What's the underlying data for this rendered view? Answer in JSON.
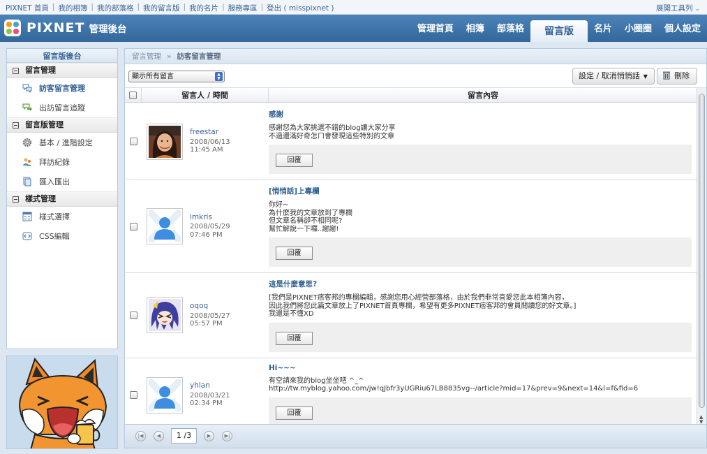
{
  "toplinks": {
    "items": [
      "PIXNET 首頁",
      "我的相簿",
      "我的部落格",
      "我的留言版",
      "我的名片",
      "服務專區",
      "登出 ( misspixnet )"
    ],
    "expand_toolbar": "展開工具列"
  },
  "header": {
    "logo_text": "PIXNET",
    "logo_sub": "管理後台",
    "nav": [
      "管理首頁",
      "相簿",
      "部落格",
      "留言版",
      "名片",
      "小圈圈",
      "個人設定"
    ],
    "active_nav": "留言版"
  },
  "sidebar": {
    "title": "留言版後台",
    "groups": [
      {
        "label": "留言管理",
        "items": [
          {
            "label": "訪客留言管理",
            "icon": "speech-bubbles-icon",
            "selected": true
          },
          {
            "label": "出訪留言追蹤",
            "icon": "bubble-arrow-icon",
            "selected": false
          }
        ]
      },
      {
        "label": "留言版管理",
        "items": [
          {
            "label": "基本 / 進階設定",
            "icon": "gear-icon",
            "selected": false
          },
          {
            "label": "拜訪紀錄",
            "icon": "visitors-icon",
            "selected": false
          },
          {
            "label": "匯入匯出",
            "icon": "import-export-icon",
            "selected": false
          }
        ]
      },
      {
        "label": "樣式管理",
        "items": [
          {
            "label": "樣式選擇",
            "icon": "layout-grid-icon",
            "selected": false
          },
          {
            "label": "CSS編輯",
            "icon": "code-icon",
            "selected": false
          }
        ]
      }
    ]
  },
  "main": {
    "breadcrumb": {
      "root": "留言管理",
      "arrow": "»",
      "current": "訪客留言管理"
    },
    "filter_select": "顯示所有留言",
    "whisper_button": "設定 / 取消悄悄話",
    "delete_button": "刪除",
    "columns": {
      "who": "留言人 / 時間",
      "content": "留言內容"
    },
    "reply_label": "回覆",
    "messages": [
      {
        "user": "freestar",
        "date": "2008/06/13",
        "time": "11:45 AM",
        "avatar": "photo",
        "title": "感謝",
        "lines": [
          "感謝您為大家挑選不錯的blog讓大家分享",
          "不過還滿好奇怎ㄇ會發現這些特別的文章"
        ]
      },
      {
        "user": "imkris",
        "date": "2008/05/29",
        "time": "07:46 PM",
        "avatar": "default",
        "title": "[悄悄話]上專欄",
        "lines": [
          "你好~",
          "為什麼我的文章放到了專欄",
          "但文章名稱卻不相同呢?",
          "幫忙解說一下囉..謝謝!"
        ]
      },
      {
        "user": "oqoq",
        "date": "2008/05/27",
        "time": "05:57 PM",
        "avatar": "anime",
        "title": "這是什麼意思?",
        "lines": [
          "[我們是PIXNET痞客邦的專欄編輯，感謝您用心經營部落格，由於我們非常喜愛您此本相簿內容，",
          "因此我們將您此篇文章放上了PIXNET首頁專欄，希望有更多PIXNET痞客邦的會員閱讀您的好文章。]",
          "我還是不懂XD"
        ]
      },
      {
        "user": "yhlan",
        "date": "2008/03/21",
        "time": "02:34 PM",
        "avatar": "default",
        "title": "Hi~~~",
        "lines": [
          "有空請來我的blog坐坐吧 ^_^",
          "http://tw.myblog.yahoo.com/jw!qJbfr3yUGRiu67LB8835vg--/article?mid=17&prev=9&next=14&l=f&fid=6"
        ]
      }
    ],
    "pager": {
      "page": "1 /3"
    }
  },
  "colors": {
    "header_blue": "#3f76ab",
    "link_blue": "#3c6394",
    "title_blue": "#2f5f93"
  }
}
